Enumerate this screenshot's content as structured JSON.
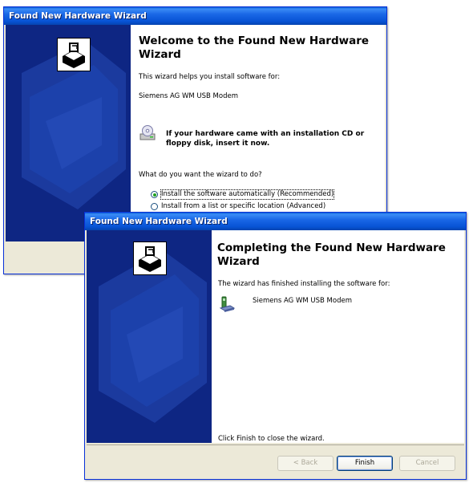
{
  "welcome_dialog": {
    "title": "Found New Hardware Wizard",
    "heading": "Welcome to the Found New Hardware Wizard",
    "intro": "This wizard helps you install software for:",
    "device": "Siemens AG WM USB Modem",
    "cd_prompt_line1": "If your hardware came with an installation CD or",
    "cd_prompt_line2": "floppy disk, insert it now.",
    "question": "What do you want the wizard to do?",
    "options": [
      {
        "label": "Install the software automatically (Recommended)",
        "checked": true
      },
      {
        "label": "Install from a list or specific location (Advanced)",
        "checked": false
      }
    ]
  },
  "completing_dialog": {
    "title": "Found New Hardware Wizard",
    "heading_line1": "Completing the Found New Hardware",
    "heading_line2": "Wizard",
    "finished_text": "The wizard has finished installing the software for:",
    "device": "Siemens AG WM USB Modem",
    "close_hint": "Click Finish to close the wizard.",
    "buttons": {
      "back": "< Back",
      "finish": "Finish",
      "cancel": "Cancel"
    }
  },
  "colors": {
    "titlebar": "#0753D5",
    "sidebar": "#0E2683",
    "dialog_bg": "#ECE9D8"
  },
  "icons": [
    "hardware-wizard-icon",
    "cd-drive-icon",
    "modem-icon"
  ]
}
